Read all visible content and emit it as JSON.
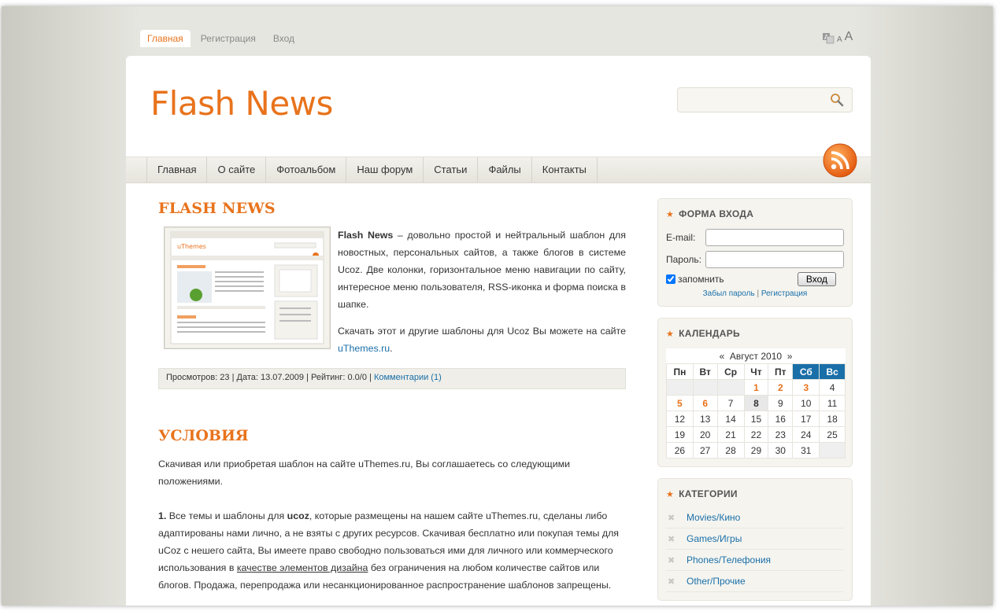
{
  "top_nav": [
    "Главная",
    "Регистрация",
    "Вход"
  ],
  "font_tools": {
    "small": "A",
    "big": "A"
  },
  "logo": "Flash News",
  "search": {
    "placeholder": ""
  },
  "main_nav": [
    "Главная",
    "О сайте",
    "Фотоальбом",
    "Наш форум",
    "Статьи",
    "Файлы",
    "Контакты"
  ],
  "post": {
    "title": "FLASH NEWS",
    "bold_lead": "Flash News",
    "text_1": " – довольно простой и нейтральный шаблон для новостных, персональных сайтов, а также блогов в системе Ucoz. Две колонки, горизонтальное меню навигации по сайту, интересное меню пользователя, RSS-иконка и форма поиска в шапке.",
    "text_2": "Скачать этот и другие шаблоны для Ucoz Вы можете на сайте ",
    "link": "uThemes.ru",
    "text_2_end": ".",
    "meta_text": "Просмотров: 23 | Дата: 13.07.2009 | Рейтинг: 0.0/0 | ",
    "meta_link": "Комментарии (1)",
    "thumbnail_title": "uThemes"
  },
  "terms": {
    "title": "УСЛОВИЯ",
    "intro": "Скачивая или приобретая шаблон на сайте uThemes.ru, Вы соглашаетесь со следующими положениями.",
    "p1_num": "1.",
    "p1_a": " Все темы и шаблоны для ",
    "p1_bold": "ucoz",
    "p1_b": ", которые размещены на нашем сайте uThemes.ru, сделаны либо адаптированы нами лично, а не взяты с других ресурсов. Скачивая бесплатно или покупая темы для uCoz с нешего сайта, Вы имеете право свободно пользоваться ими для личного или коммерческого использования в ",
    "p1_link": "качестве элементов дизайна",
    "p1_c": " без ограничения на любом количестве сайтов или блогов. Продажа, перепродажа или несанкционированное распространение шаблонов запрещены."
  },
  "login": {
    "title": "ФОРМА ВХОДА",
    "email_label": "E-mail:",
    "password_label": "Пароль:",
    "remember_label": "запомнить",
    "remember_checked": true,
    "submit": "Вход",
    "forgot": "Забыл пароль",
    "sep": "|",
    "register": "Регистрация"
  },
  "calendar": {
    "title": "КАЛЕНДАРЬ",
    "prev": "«",
    "month": "Август 2010",
    "next": "»",
    "weekdays": [
      "Пн",
      "Вт",
      "Ср",
      "Чт",
      "Пт",
      "Сб",
      "Вс"
    ],
    "weeks": [
      [
        "",
        "",
        "",
        "1",
        "2",
        "3",
        "4"
      ],
      [
        "5",
        "6",
        "7",
        "8",
        "9",
        "10",
        "11"
      ],
      [
        "12",
        "13",
        "14",
        "15",
        "16",
        "17",
        "18"
      ],
      [
        "19",
        "20",
        "21",
        "22",
        "23",
        "24",
        "25"
      ],
      [
        "26",
        "27",
        "28",
        "29",
        "30",
        "31",
        ""
      ]
    ],
    "event_days": [
      "1",
      "2",
      "3",
      "5",
      "6"
    ],
    "today": "8",
    "accent_color": "#1a6fa8",
    "event_color": "#e8731c"
  },
  "categories": {
    "title": "КАТЕГОРИИ",
    "items": [
      "Movies/Кино",
      "Games/Игры",
      "Phones/Телефония",
      "Other/Прочие"
    ]
  },
  "colors": {
    "accent": "#e8731c",
    "link": "#1a6fa8"
  }
}
